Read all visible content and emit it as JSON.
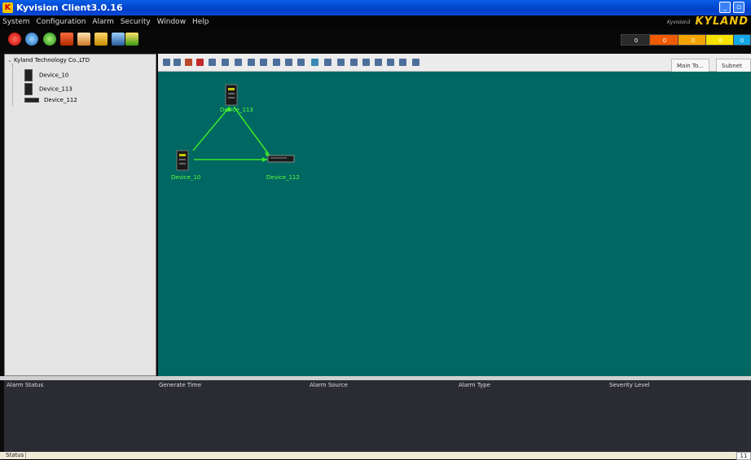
{
  "window": {
    "title": "Kyvision Client3.0.16"
  },
  "menu": {
    "items": [
      "System",
      "Configuration",
      "Alarm",
      "Security",
      "Window",
      "Help"
    ],
    "brand_sub": "Kyvision3",
    "brand_logo": "KYLAND"
  },
  "alarm_counters": [
    {
      "value": "0",
      "color": "#2a2a2a"
    },
    {
      "value": "0",
      "color": "#f05a00"
    },
    {
      "value": "0",
      "color": "#f4a300"
    },
    {
      "value": "0",
      "color": "#f7e200"
    },
    {
      "value": "0",
      "color": "#12a7e8"
    }
  ],
  "tree": {
    "root": "Kyland Technology Co.,LTD",
    "items": [
      {
        "label": "Device_10",
        "icon": "switch-icon"
      },
      {
        "label": "Device_113",
        "icon": "switch-icon"
      },
      {
        "label": "Device_112",
        "icon": "router-icon"
      }
    ]
  },
  "view_tabs": [
    "Main To...",
    "Subnet T..."
  ],
  "topology": {
    "nodes": [
      {
        "id": "Device_113",
        "label": "Device_113"
      },
      {
        "id": "Device_10",
        "label": "Device_10"
      },
      {
        "id": "Device_112",
        "label": "Device_112"
      }
    ],
    "link_color": "#39e82a",
    "label_color": "#5cff3c",
    "background": "#006762"
  },
  "alarm_table": {
    "columns": [
      "Alarm Status",
      "Generate Time",
      "Alarm Source",
      "Alarm Type",
      "Severity Level"
    ]
  },
  "statusbar": {
    "label": "Status",
    "count": "11"
  }
}
